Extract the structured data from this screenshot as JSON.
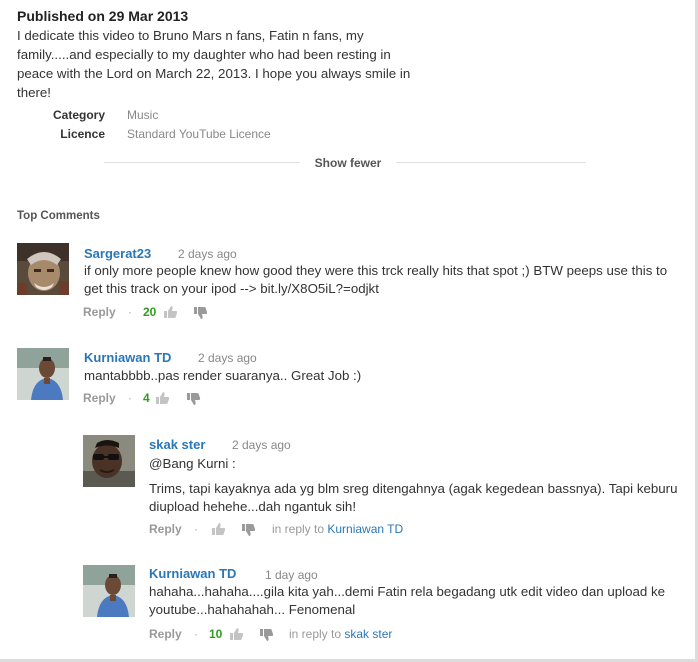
{
  "video": {
    "published": "Published on 29 Mar 2013",
    "description": "I dedicate this video to Bruno Mars n fans, Fatin n fans, my\nfamily.....and especially to my daughter who had been resting in\npeace with the Lord on March 22, 2013. I hope you always smile in\nthere!",
    "category_label": "Category",
    "category_value": "Music",
    "licence_label": "Licence",
    "licence_value": "Standard YouTube Licence",
    "show_fewer": "Show fewer"
  },
  "comments_section": {
    "heading": "Top Comments"
  },
  "comments": [
    {
      "author": "Sargerat23",
      "time": "2 days ago",
      "body": "if only more people knew how good they were this trck really hits that spot ;) BTW peeps use this to get this track on your ipod --> bit.ly/X8O5iL?=odjkt",
      "reply": "Reply",
      "dot": "·",
      "likes": "20"
    },
    {
      "author": "Kurniawan TD",
      "time": "2 days ago",
      "body": "mantabbbb..pas render suaranya.. Great Job :)",
      "reply": "Reply",
      "dot": "·",
      "likes": "4"
    },
    {
      "author": "skak ster",
      "time": "2 days ago",
      "body_line1": "@Bang Kurni :",
      "body": "Trims, tapi kayaknya ada yg blm sreg ditengahnya (agak kegedean bassnya). Tapi keburu diupload hehehe...dah ngantuk sih!",
      "reply": "Reply",
      "dot": "·",
      "in_reply_prefix": "in reply to ",
      "in_reply_to": "Kurniawan TD"
    },
    {
      "author": "Kurniawan TD",
      "time": "1 day ago",
      "body": "hahaha...hahaha....gila kita yah...demi Fatin rela begadang utk edit video dan upload ke youtube...hahahahah... Fenomenal",
      "reply": "Reply",
      "dot": "·",
      "likes": "10",
      "in_reply_prefix": "in reply to ",
      "in_reply_to": "skak ster"
    }
  ]
}
